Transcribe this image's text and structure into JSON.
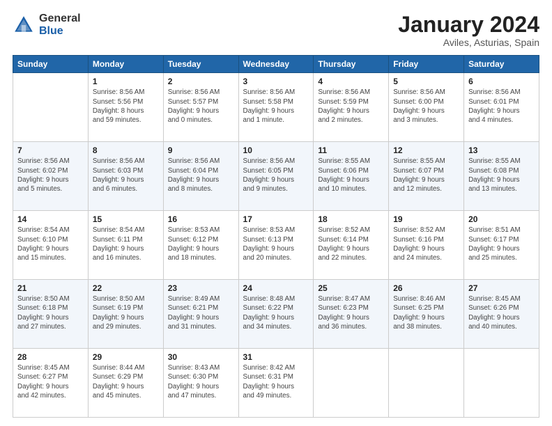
{
  "logo": {
    "general": "General",
    "blue": "Blue"
  },
  "title": "January 2024",
  "location": "Aviles, Asturias, Spain",
  "headers": [
    "Sunday",
    "Monday",
    "Tuesday",
    "Wednesday",
    "Thursday",
    "Friday",
    "Saturday"
  ],
  "weeks": [
    [
      {
        "day": "",
        "info": ""
      },
      {
        "day": "1",
        "info": "Sunrise: 8:56 AM\nSunset: 5:56 PM\nDaylight: 8 hours\nand 59 minutes."
      },
      {
        "day": "2",
        "info": "Sunrise: 8:56 AM\nSunset: 5:57 PM\nDaylight: 9 hours\nand 0 minutes."
      },
      {
        "day": "3",
        "info": "Sunrise: 8:56 AM\nSunset: 5:58 PM\nDaylight: 9 hours\nand 1 minute."
      },
      {
        "day": "4",
        "info": "Sunrise: 8:56 AM\nSunset: 5:59 PM\nDaylight: 9 hours\nand 2 minutes."
      },
      {
        "day": "5",
        "info": "Sunrise: 8:56 AM\nSunset: 6:00 PM\nDaylight: 9 hours\nand 3 minutes."
      },
      {
        "day": "6",
        "info": "Sunrise: 8:56 AM\nSunset: 6:01 PM\nDaylight: 9 hours\nand 4 minutes."
      }
    ],
    [
      {
        "day": "7",
        "info": "Sunrise: 8:56 AM\nSunset: 6:02 PM\nDaylight: 9 hours\nand 5 minutes."
      },
      {
        "day": "8",
        "info": "Sunrise: 8:56 AM\nSunset: 6:03 PM\nDaylight: 9 hours\nand 6 minutes."
      },
      {
        "day": "9",
        "info": "Sunrise: 8:56 AM\nSunset: 6:04 PM\nDaylight: 9 hours\nand 8 minutes."
      },
      {
        "day": "10",
        "info": "Sunrise: 8:56 AM\nSunset: 6:05 PM\nDaylight: 9 hours\nand 9 minutes."
      },
      {
        "day": "11",
        "info": "Sunrise: 8:55 AM\nSunset: 6:06 PM\nDaylight: 9 hours\nand 10 minutes."
      },
      {
        "day": "12",
        "info": "Sunrise: 8:55 AM\nSunset: 6:07 PM\nDaylight: 9 hours\nand 12 minutes."
      },
      {
        "day": "13",
        "info": "Sunrise: 8:55 AM\nSunset: 6:08 PM\nDaylight: 9 hours\nand 13 minutes."
      }
    ],
    [
      {
        "day": "14",
        "info": "Sunrise: 8:54 AM\nSunset: 6:10 PM\nDaylight: 9 hours\nand 15 minutes."
      },
      {
        "day": "15",
        "info": "Sunrise: 8:54 AM\nSunset: 6:11 PM\nDaylight: 9 hours\nand 16 minutes."
      },
      {
        "day": "16",
        "info": "Sunrise: 8:53 AM\nSunset: 6:12 PM\nDaylight: 9 hours\nand 18 minutes."
      },
      {
        "day": "17",
        "info": "Sunrise: 8:53 AM\nSunset: 6:13 PM\nDaylight: 9 hours\nand 20 minutes."
      },
      {
        "day": "18",
        "info": "Sunrise: 8:52 AM\nSunset: 6:14 PM\nDaylight: 9 hours\nand 22 minutes."
      },
      {
        "day": "19",
        "info": "Sunrise: 8:52 AM\nSunset: 6:16 PM\nDaylight: 9 hours\nand 24 minutes."
      },
      {
        "day": "20",
        "info": "Sunrise: 8:51 AM\nSunset: 6:17 PM\nDaylight: 9 hours\nand 25 minutes."
      }
    ],
    [
      {
        "day": "21",
        "info": "Sunrise: 8:50 AM\nSunset: 6:18 PM\nDaylight: 9 hours\nand 27 minutes."
      },
      {
        "day": "22",
        "info": "Sunrise: 8:50 AM\nSunset: 6:19 PM\nDaylight: 9 hours\nand 29 minutes."
      },
      {
        "day": "23",
        "info": "Sunrise: 8:49 AM\nSunset: 6:21 PM\nDaylight: 9 hours\nand 31 minutes."
      },
      {
        "day": "24",
        "info": "Sunrise: 8:48 AM\nSunset: 6:22 PM\nDaylight: 9 hours\nand 34 minutes."
      },
      {
        "day": "25",
        "info": "Sunrise: 8:47 AM\nSunset: 6:23 PM\nDaylight: 9 hours\nand 36 minutes."
      },
      {
        "day": "26",
        "info": "Sunrise: 8:46 AM\nSunset: 6:25 PM\nDaylight: 9 hours\nand 38 minutes."
      },
      {
        "day": "27",
        "info": "Sunrise: 8:45 AM\nSunset: 6:26 PM\nDaylight: 9 hours\nand 40 minutes."
      }
    ],
    [
      {
        "day": "28",
        "info": "Sunrise: 8:45 AM\nSunset: 6:27 PM\nDaylight: 9 hours\nand 42 minutes."
      },
      {
        "day": "29",
        "info": "Sunrise: 8:44 AM\nSunset: 6:29 PM\nDaylight: 9 hours\nand 45 minutes."
      },
      {
        "day": "30",
        "info": "Sunrise: 8:43 AM\nSunset: 6:30 PM\nDaylight: 9 hours\nand 47 minutes."
      },
      {
        "day": "31",
        "info": "Sunrise: 8:42 AM\nSunset: 6:31 PM\nDaylight: 9 hours\nand 49 minutes."
      },
      {
        "day": "",
        "info": ""
      },
      {
        "day": "",
        "info": ""
      },
      {
        "day": "",
        "info": ""
      }
    ]
  ]
}
